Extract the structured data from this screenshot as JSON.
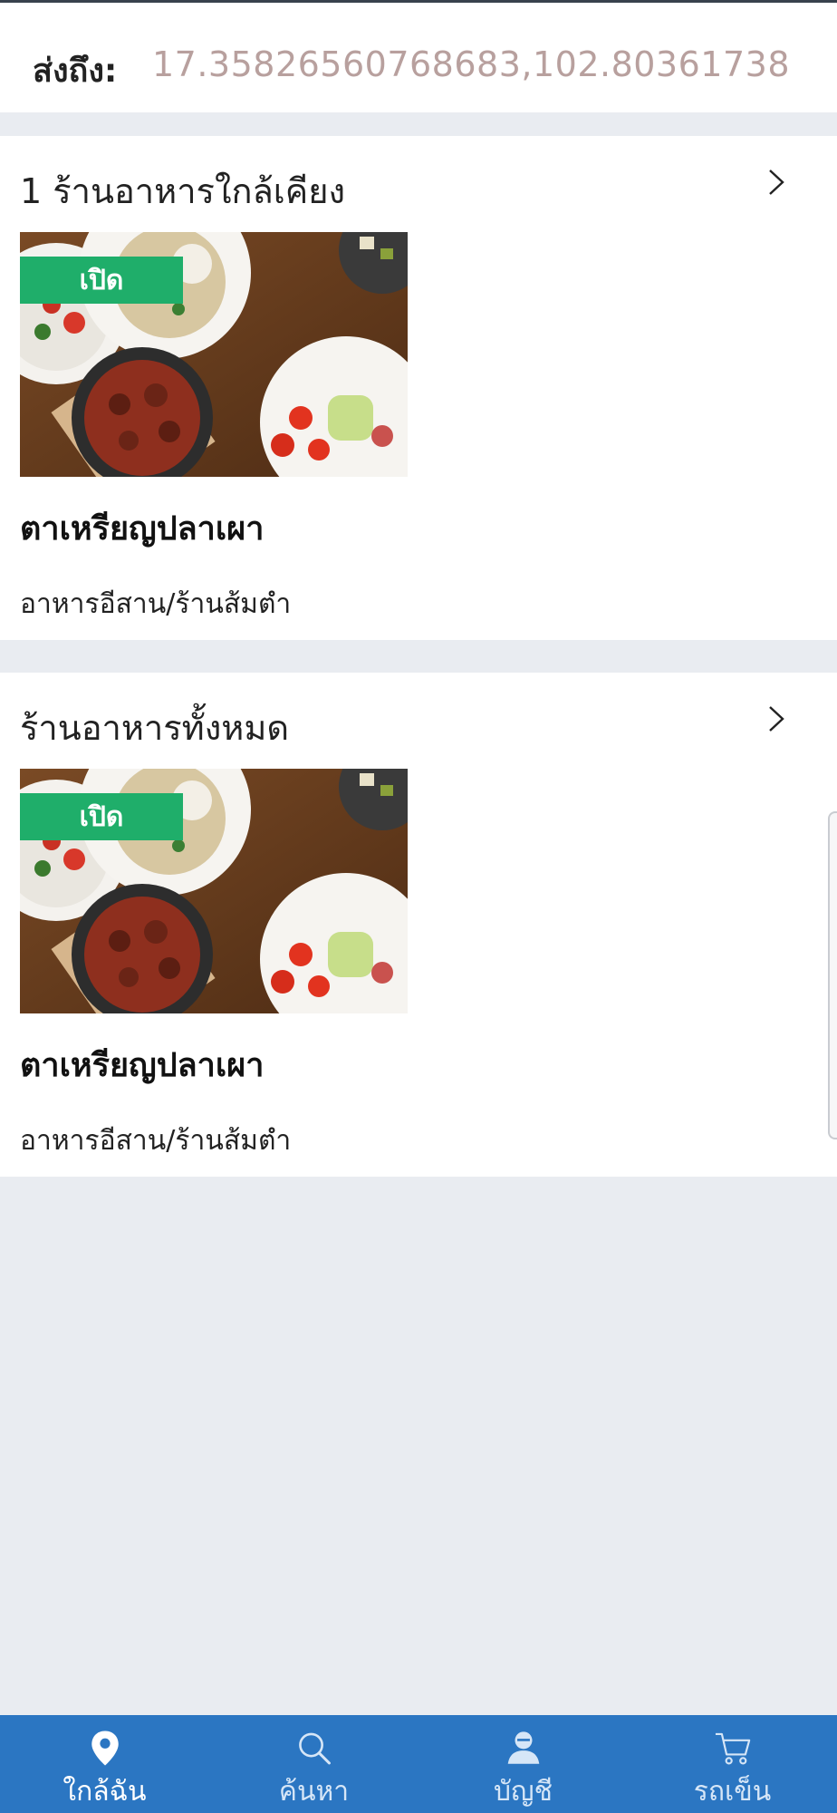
{
  "header": {
    "deliver_label": "ส่งถึง:",
    "deliver_value": "17.35826560768683,102.80361738"
  },
  "sections": [
    {
      "title": "1 ร้านอาหารใกล้เคียง",
      "card": {
        "badge": "เปิด",
        "name": "ตาเหรียญปลาเผา",
        "category": "อาหารอีสาน/ร้านส้มตำ"
      }
    },
    {
      "title": "ร้านอาหารทั้งหมด",
      "card": {
        "badge": "เปิด",
        "name": "ตาเหรียญปลาเผา",
        "category": "อาหารอีสาน/ร้านส้มตำ"
      }
    }
  ],
  "bottom_nav": [
    {
      "label": "ใกล้ฉัน",
      "icon": "location-pin-icon",
      "active": true
    },
    {
      "label": "ค้นหา",
      "icon": "search-icon",
      "active": false
    },
    {
      "label": "บัญชี",
      "icon": "account-icon",
      "active": false
    },
    {
      "label": "รถเข็น",
      "icon": "cart-icon",
      "active": false
    }
  ],
  "colors": {
    "badge_open": "#1fae6a",
    "nav_bar": "#2b76c2",
    "coords_text": "#b8a09e",
    "background": "#e9ecf1"
  }
}
